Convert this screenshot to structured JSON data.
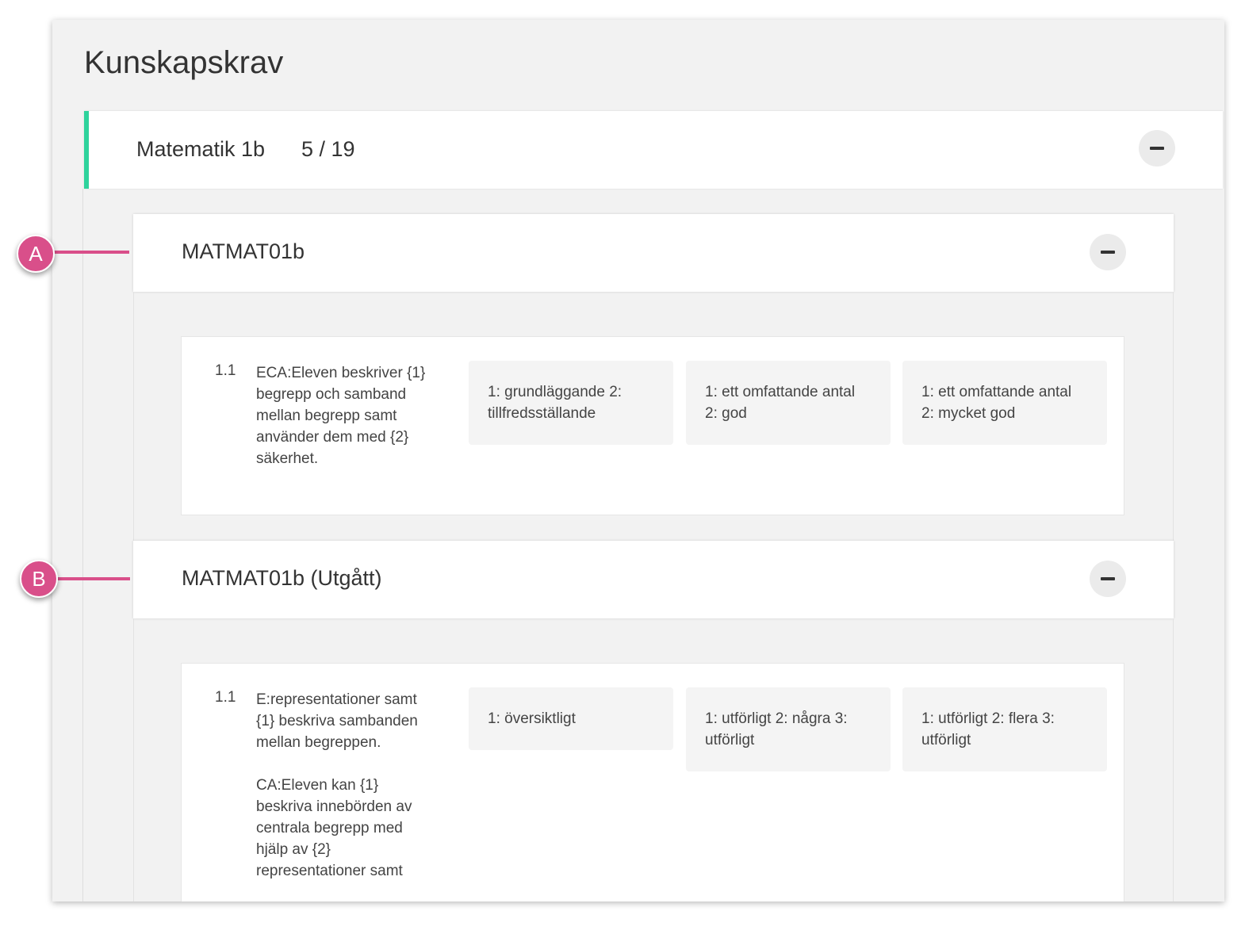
{
  "page": {
    "title": "Kunskapskrav"
  },
  "course": {
    "title": "Matematik 1b",
    "progress": "5 / 19"
  },
  "sections": [
    {
      "title": "MATMAT01b",
      "requirement": {
        "number": "1.1",
        "text": "ECA:Eleven beskriver {1} begrepp och samband mellan begrepp samt använder dem med {2} säkerhet.",
        "levels": [
          "1: grundläggande 2: tillfredsställande",
          "1: ett omfattande antal 2: god",
          "1: ett omfattande antal 2: mycket god"
        ]
      }
    },
    {
      "title": "MATMAT01b (Utgått)",
      "requirement": {
        "number": "1.1",
        "text": "E:representationer samt {1} beskriva sambanden mellan begreppen.\n\nCA:Eleven kan {1} beskriva innebörden av centrala begrepp med hjälp av {2} representationer samt",
        "levels": [
          "1: översiktligt",
          "1: utförligt 2: några 3: utförligt",
          "1: utförligt 2: flera 3: utförligt"
        ]
      }
    }
  ],
  "callouts": {
    "a": "A",
    "b": "B"
  },
  "colors": {
    "accent": "#2ed39c",
    "callout": "#d94f8a"
  }
}
